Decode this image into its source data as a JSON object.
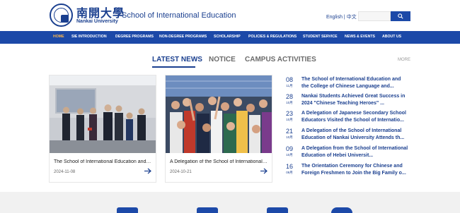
{
  "header": {
    "logo_cn": "南開大學",
    "logo_en": "Nankai University",
    "site_title": "School of International Education",
    "lang_english": "English",
    "lang_sep": "|",
    "lang_chinese": "中文"
  },
  "nav": {
    "items": [
      {
        "label": "HOME",
        "active": true
      },
      {
        "label": "SIE INTRODUCTION"
      },
      {
        "label": "DEGREE PROGRAMS"
      },
      {
        "label": "NON-DEGREE PROGRAMS"
      },
      {
        "label": "SCHOLARSHIP"
      },
      {
        "label": "POLICIES & REGULATIONS"
      },
      {
        "label": "STUDENT SERVICE"
      },
      {
        "label": "NEWS & EVENTS"
      },
      {
        "label": "ABOUT US"
      }
    ]
  },
  "tabs": {
    "latest": "LATEST NEWS",
    "notice": "NOTICE",
    "campus": "CAMPUS ACTIVITIES",
    "more": "MORE"
  },
  "cards": [
    {
      "title": "The School of International Education and the College of Chinese Language and Culture",
      "date": "2024-11-08"
    },
    {
      "title": "A Delegation of the School of International Education of Nankai University",
      "date": "2024-10-21"
    }
  ],
  "news": [
    {
      "day": "08",
      "month": "11月",
      "text": "The School of International Education and the College of Chinese Language and..."
    },
    {
      "day": "28",
      "month": "10月",
      "text": "Nankai Students Achieved Great Success in 2024 \"Chinese Teaching Heroes\" ..."
    },
    {
      "day": "23",
      "month": "10月",
      "text": "A Delegation of Japanese Secondary School Educators Visited the School of Internatio..."
    },
    {
      "day": "21",
      "month": "10月",
      "text": "A Delegation of the School of International Education of Nankai University Attends th..."
    },
    {
      "day": "09",
      "month": "10月",
      "text": "A Delegation from the School of International Education of Hebei Universit..."
    },
    {
      "day": "16",
      "month": "09月",
      "text": "The Orientation Ceremony for Chinese and Foreign Freshmen to Join the Big Family o..."
    }
  ],
  "colors": {
    "brand_blue": "#1c49a8",
    "title_blue": "#1a3f8f",
    "nav_active": "#ffb84a"
  }
}
